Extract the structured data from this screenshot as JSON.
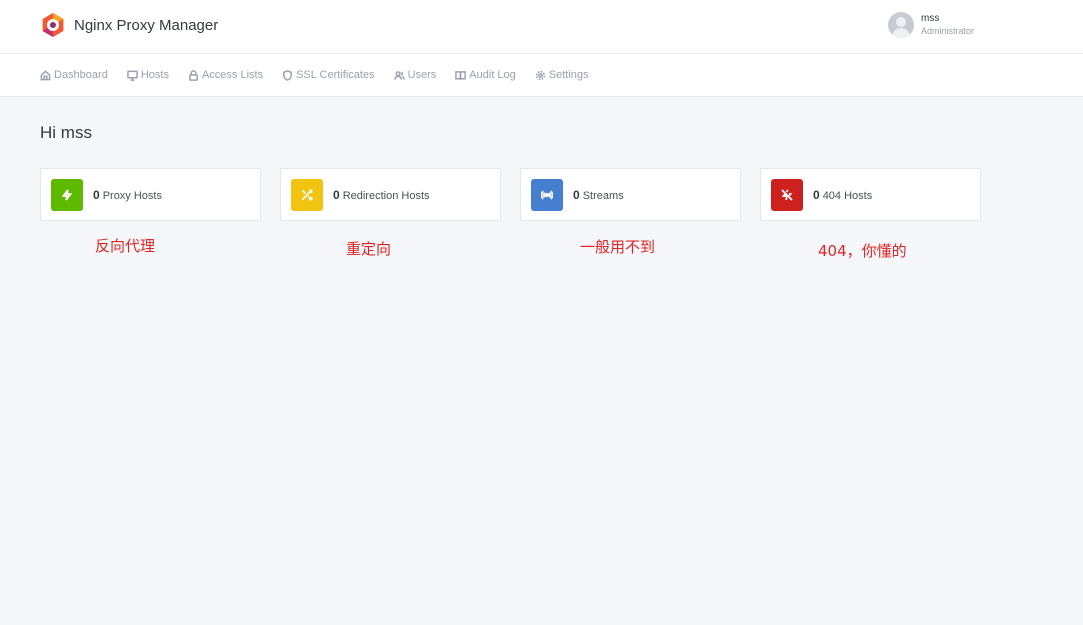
{
  "header": {
    "app_title": "Nginx Proxy Manager",
    "user": {
      "name": "mss",
      "role": "Administrator"
    }
  },
  "nav": {
    "items": [
      {
        "label": "Dashboard",
        "icon": "home-icon"
      },
      {
        "label": "Hosts",
        "icon": "monitor-icon"
      },
      {
        "label": "Access Lists",
        "icon": "lock-icon"
      },
      {
        "label": "SSL Certificates",
        "icon": "shield-icon"
      },
      {
        "label": "Users",
        "icon": "users-icon"
      },
      {
        "label": "Audit Log",
        "icon": "book-icon"
      },
      {
        "label": "Settings",
        "icon": "gear-icon"
      }
    ]
  },
  "main": {
    "greeting": "Hi mss",
    "cards": [
      {
        "count": "0",
        "label": "Proxy Hosts",
        "icon": "zap-icon",
        "color": "#5eba00"
      },
      {
        "count": "0",
        "label": "Redirection Hosts",
        "icon": "shuffle-icon",
        "color": "#f1c40f"
      },
      {
        "count": "0",
        "label": "Streams",
        "icon": "radio-icon",
        "color": "#467fcf"
      },
      {
        "count": "0",
        "label": "404 Hosts",
        "icon": "zap-off-icon",
        "color": "#cd201f"
      }
    ],
    "annotations": [
      "反向代理",
      "重定向",
      "一般用不到",
      "404，你懂的"
    ]
  }
}
